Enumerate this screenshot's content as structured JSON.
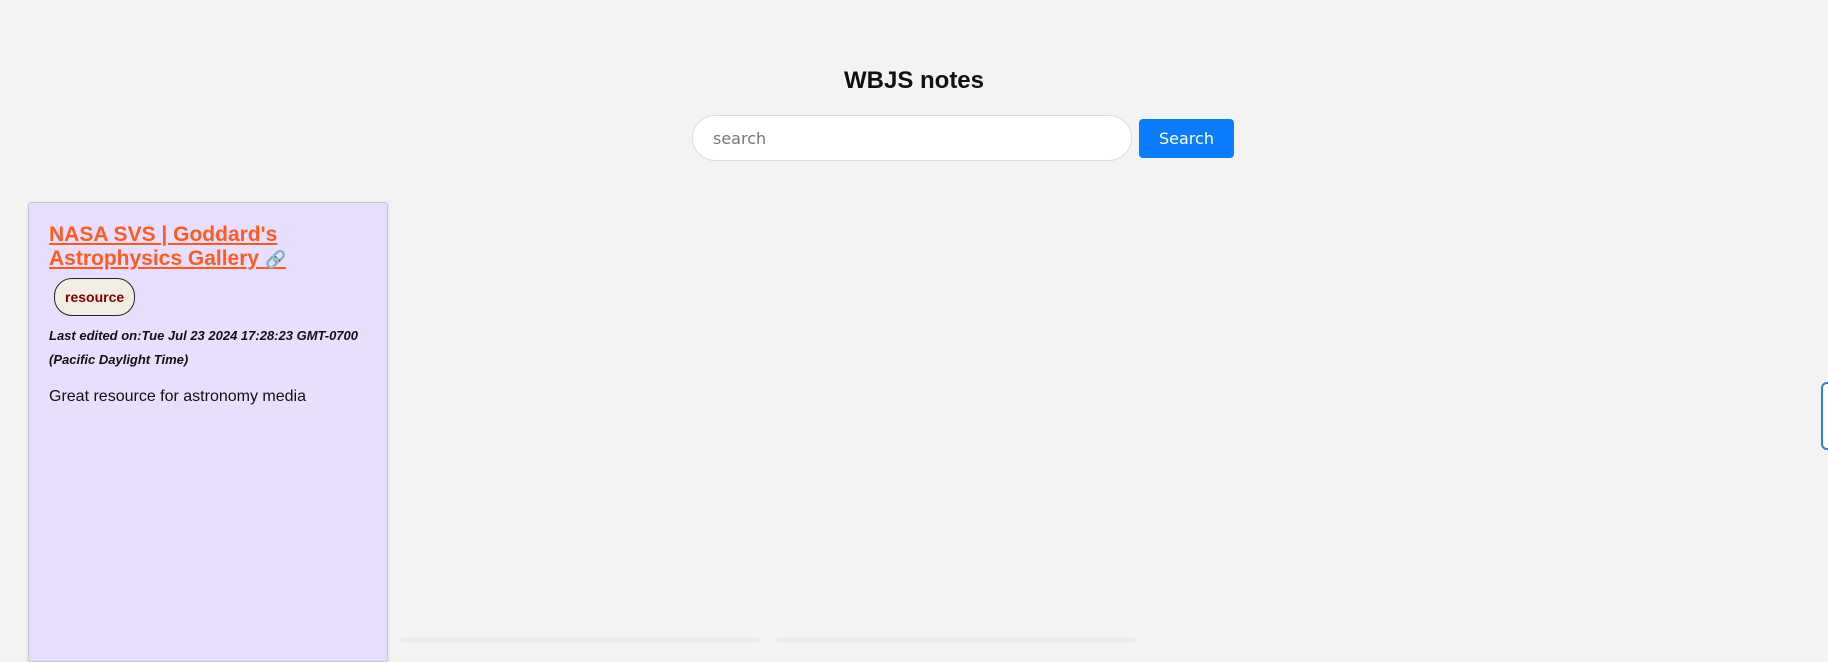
{
  "page": {
    "title": "WBJS notes"
  },
  "search": {
    "placeholder": "search",
    "value": "",
    "button_label": "Search"
  },
  "notes": [
    {
      "title": "NASA SVS | Goddard's Astrophysics Gallery",
      "link_icon": "🔗",
      "tag": "resource",
      "last_edited": "Last edited on:Tue Jul 23 2024 17:28:23 GMT-0700 (Pacific Daylight Time)",
      "body": "Great resource for astronomy media",
      "color": "#e8defd"
    }
  ],
  "colors": {
    "background": "#f3f3f3",
    "accent": "#0a7cff",
    "title_link": "#ff5a1f",
    "tag_text": "#7a0000"
  }
}
